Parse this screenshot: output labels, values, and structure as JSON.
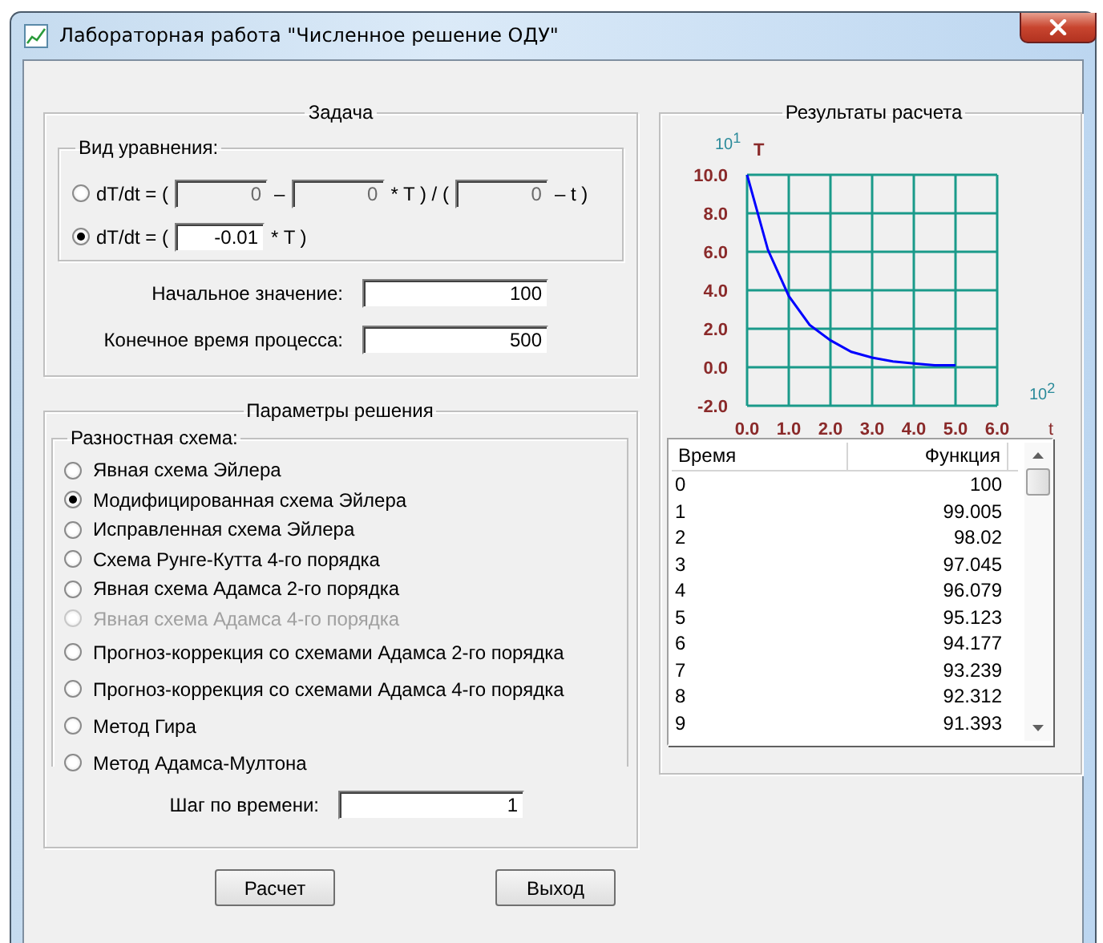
{
  "window": {
    "title": "Лабораторная работа \"Численное решение ОДУ\""
  },
  "task": {
    "title": "Задача",
    "equation": {
      "title": "Вид уравнения:",
      "options": [
        {
          "selected": false,
          "parts": [
            {
              "kind": "text",
              "text": "dT/dt = ("
            },
            {
              "kind": "field",
              "value": "0",
              "disabled": true
            },
            {
              "kind": "text",
              "text": "–"
            },
            {
              "kind": "field",
              "value": "0",
              "disabled": true
            },
            {
              "kind": "text",
              "text": "* T ) / ("
            },
            {
              "kind": "field",
              "value": "0",
              "disabled": true
            },
            {
              "kind": "text",
              "text": "– t )"
            }
          ]
        },
        {
          "selected": true,
          "parts": [
            {
              "kind": "text",
              "text": "dT/dt = ("
            },
            {
              "kind": "field",
              "value": "-0.01",
              "disabled": false
            },
            {
              "kind": "text",
              "text": "* T )"
            }
          ]
        }
      ]
    },
    "fields": [
      {
        "label": "Начальное значение:",
        "value": "100"
      },
      {
        "label": "Конечное время процесса:",
        "value": "500"
      }
    ]
  },
  "params": {
    "title": "Параметры решения",
    "scheme": {
      "title": "Разностная схема:",
      "options": [
        {
          "label": "Явная схема Эйлера",
          "selected": false,
          "disabled": false
        },
        {
          "label": "Модифицированная схема Эйлера",
          "selected": true,
          "disabled": false
        },
        {
          "label": "Исправленная схема Эйлера",
          "selected": false,
          "disabled": false
        },
        {
          "label": "Схема Рунге-Кутта 4-го порядка",
          "selected": false,
          "disabled": false
        },
        {
          "label": "Явная схема Адамса 2-го порядка",
          "selected": false,
          "disabled": false
        },
        {
          "label": "Явная схема Адамса 4-го порядка",
          "selected": false,
          "disabled": true
        },
        {
          "label": "Прогноз-коррекция со схемами  Адамса 2-го порядка",
          "selected": false,
          "disabled": false
        },
        {
          "label": "Прогноз-коррекция со схемами  Адамса 4-го порядка",
          "selected": false,
          "disabled": false
        },
        {
          "label": "Метод Гира",
          "selected": false,
          "disabled": false
        },
        {
          "label": "Метод Адамса-Мултона",
          "selected": false,
          "disabled": false
        }
      ]
    },
    "step": {
      "label": "Шаг по времени:",
      "value": "1"
    }
  },
  "results": {
    "title": "Результаты расчета",
    "y_scale": "10$^{1}$",
    "x_scale": "10$^{2}$",
    "chart_data": {
      "type": "line",
      "xlabel": "t",
      "ylabel": "T",
      "x": [
        0,
        0.5,
        1,
        1.5,
        2,
        2.5,
        3,
        3.5,
        4,
        4.5,
        5
      ],
      "series": [
        {
          "color": "#0000ff",
          "values": [
            10,
            6.1,
            3.7,
            2.2,
            1.4,
            0.8,
            0.5,
            0.3,
            0.2,
            0.1,
            0.1
          ]
        }
      ],
      "grid": true,
      "xlim": [
        0,
        6
      ],
      "ylim": [
        -2,
        10
      ],
      "xticks": [
        {
          "value": 0,
          "label": "0.0"
        },
        {
          "value": 1,
          "label": "1.0"
        },
        {
          "value": 2,
          "label": "2.0"
        },
        {
          "value": 3,
          "label": "3.0"
        },
        {
          "value": 4,
          "label": "4.0"
        },
        {
          "value": 5,
          "label": "5.0"
        },
        {
          "value": 6,
          "label": "6.0"
        }
      ],
      "yticks": [
        {
          "value": -2,
          "label": "-2.0"
        },
        {
          "value": 0,
          "label": "0.0"
        },
        {
          "value": 2,
          "label": "2.0"
        },
        {
          "value": 4,
          "label": "4.0"
        },
        {
          "value": 6,
          "label": "6.0"
        },
        {
          "value": 8,
          "label": "8.0"
        },
        {
          "value": 10,
          "label": "10.0"
        }
      ]
    },
    "table": {
      "columns": [
        "Время",
        "Функция"
      ],
      "rows": [
        [
          "0",
          "100"
        ],
        [
          "1",
          "99.005"
        ],
        [
          "2",
          "98.02"
        ],
        [
          "3",
          "97.045"
        ],
        [
          "4",
          "96.079"
        ],
        [
          "5",
          "95.123"
        ],
        [
          "6",
          "94.177"
        ],
        [
          "7",
          "93.239"
        ],
        [
          "8",
          "92.312"
        ],
        [
          "9",
          "91.393"
        ]
      ]
    }
  },
  "buttons": [
    "Расчет",
    "Выход"
  ]
}
